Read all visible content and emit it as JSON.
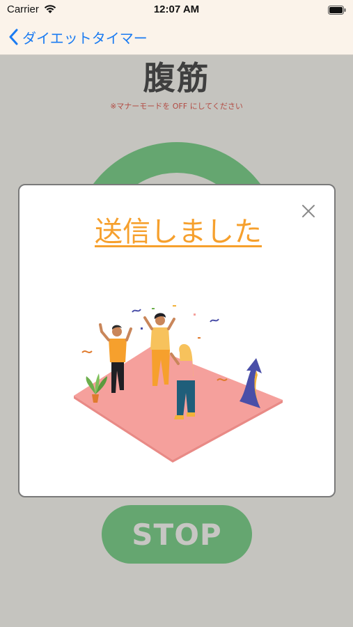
{
  "status_bar": {
    "carrier": "Carrier",
    "time": "12:07 AM"
  },
  "nav": {
    "back_label": "ダイエットタイマー"
  },
  "screen": {
    "title": "腹筋",
    "notice": "※マナーモードを OFF にしてください",
    "stop_label": "STOP"
  },
  "modal": {
    "title": "送信しました"
  },
  "colors": {
    "accent_green": "#65a670",
    "link_blue": "#1a7bf2",
    "title_orange": "#f6a02d",
    "background": "#c5c4bf"
  },
  "icons": [
    "wifi-icon",
    "battery-icon",
    "back-chevron-icon",
    "close-icon"
  ]
}
